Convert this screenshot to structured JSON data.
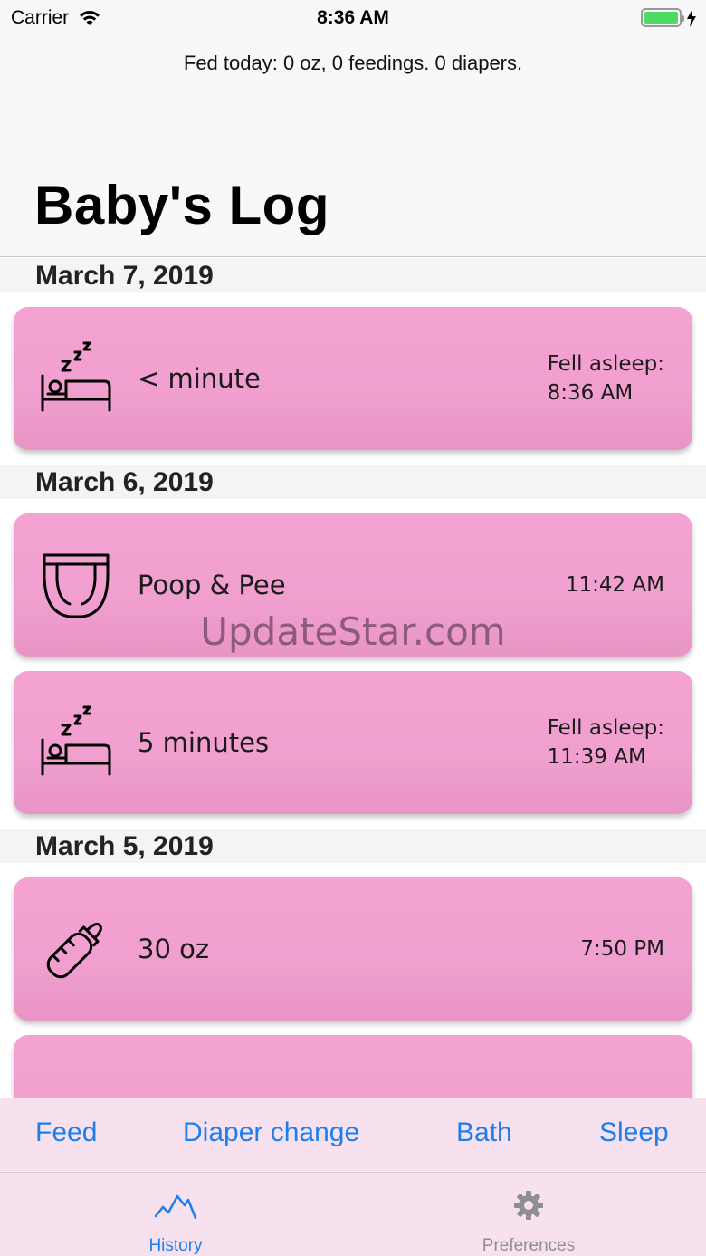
{
  "status": {
    "carrier": "Carrier",
    "time": "8:36 AM"
  },
  "header": {
    "summary": "Fed today: 0 oz, 0 feedings. 0 diapers.",
    "title": "Baby's Log"
  },
  "sections": [
    {
      "date": "March 7, 2019",
      "entries": [
        {
          "icon": "sleep-icon",
          "label": "< minute",
          "time_line1": "Fell asleep:",
          "time_line2": "8:36 AM"
        }
      ]
    },
    {
      "date": "March 6, 2019",
      "entries": [
        {
          "icon": "diaper-icon",
          "label": "Poop & Pee",
          "time": "11:42 AM"
        },
        {
          "icon": "sleep-icon",
          "label": "5 minutes",
          "time_line1": "Fell asleep:",
          "time_line2": "11:39 AM"
        }
      ]
    },
    {
      "date": "March 5, 2019",
      "entries": [
        {
          "icon": "bottle-icon",
          "label": "30 oz",
          "time": "7:50 PM"
        }
      ]
    }
  ],
  "watermark": "UpdateStar.com",
  "actions": {
    "feed": "Feed",
    "diaper": "Diaper change",
    "bath": "Bath",
    "sleep": "Sleep"
  },
  "tabs": {
    "history": "History",
    "preferences": "Preferences"
  },
  "colors": {
    "card": "#f4a2d2",
    "accent": "#1b7ff0",
    "bar_background": "#f8e1ee"
  }
}
